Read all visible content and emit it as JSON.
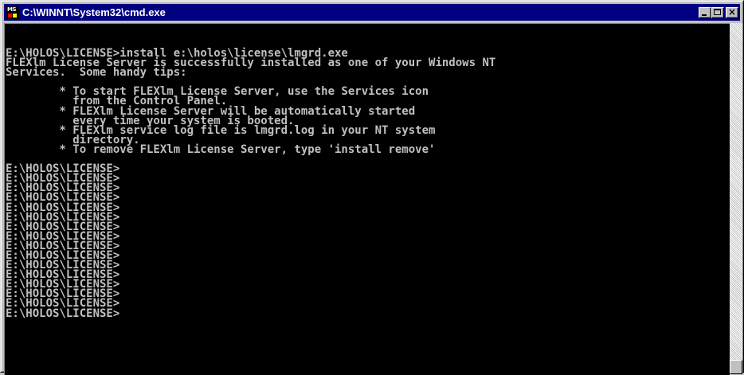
{
  "window": {
    "title": "C:\\WINNT\\System32\\cmd.exe",
    "icon": "ms-dos-icon",
    "controls": [
      "minimize-icon",
      "maximize-icon",
      "close-icon"
    ]
  },
  "console": {
    "lines": [
      "E:\\HOLOS\\LICENSE>install e:\\holos\\license\\lmgrd.exe",
      "FLEXlm License Server is successfully installed as one of your Windows NT",
      "Services.  Some handy tips:",
      "",
      "        * To start FLEXlm License Server, use the Services icon",
      "          from the Control Panel.",
      "        * FLEXlm License Server will be automatically started",
      "          every time your system is booted.",
      "        * FLEXlm service log file is lmgrd.log in your NT system",
      "          directory.",
      "        * To remove FLEXlm License Server, type 'install remove'",
      "",
      "E:\\HOLOS\\LICENSE>",
      "E:\\HOLOS\\LICENSE>",
      "E:\\HOLOS\\LICENSE>",
      "E:\\HOLOS\\LICENSE>",
      "E:\\HOLOS\\LICENSE>",
      "E:\\HOLOS\\LICENSE>",
      "E:\\HOLOS\\LICENSE>",
      "E:\\HOLOS\\LICENSE>",
      "E:\\HOLOS\\LICENSE>",
      "E:\\HOLOS\\LICENSE>",
      "E:\\HOLOS\\LICENSE>",
      "E:\\HOLOS\\LICENSE>",
      "E:\\HOLOS\\LICENSE>",
      "E:\\HOLOS\\LICENSE>",
      "E:\\HOLOS\\LICENSE>",
      "E:\\HOLOS\\LICENSE>"
    ]
  },
  "colors": {
    "titlebar": "#000080",
    "console_bg": "#000000",
    "console_fg": "#c0c0c0"
  }
}
